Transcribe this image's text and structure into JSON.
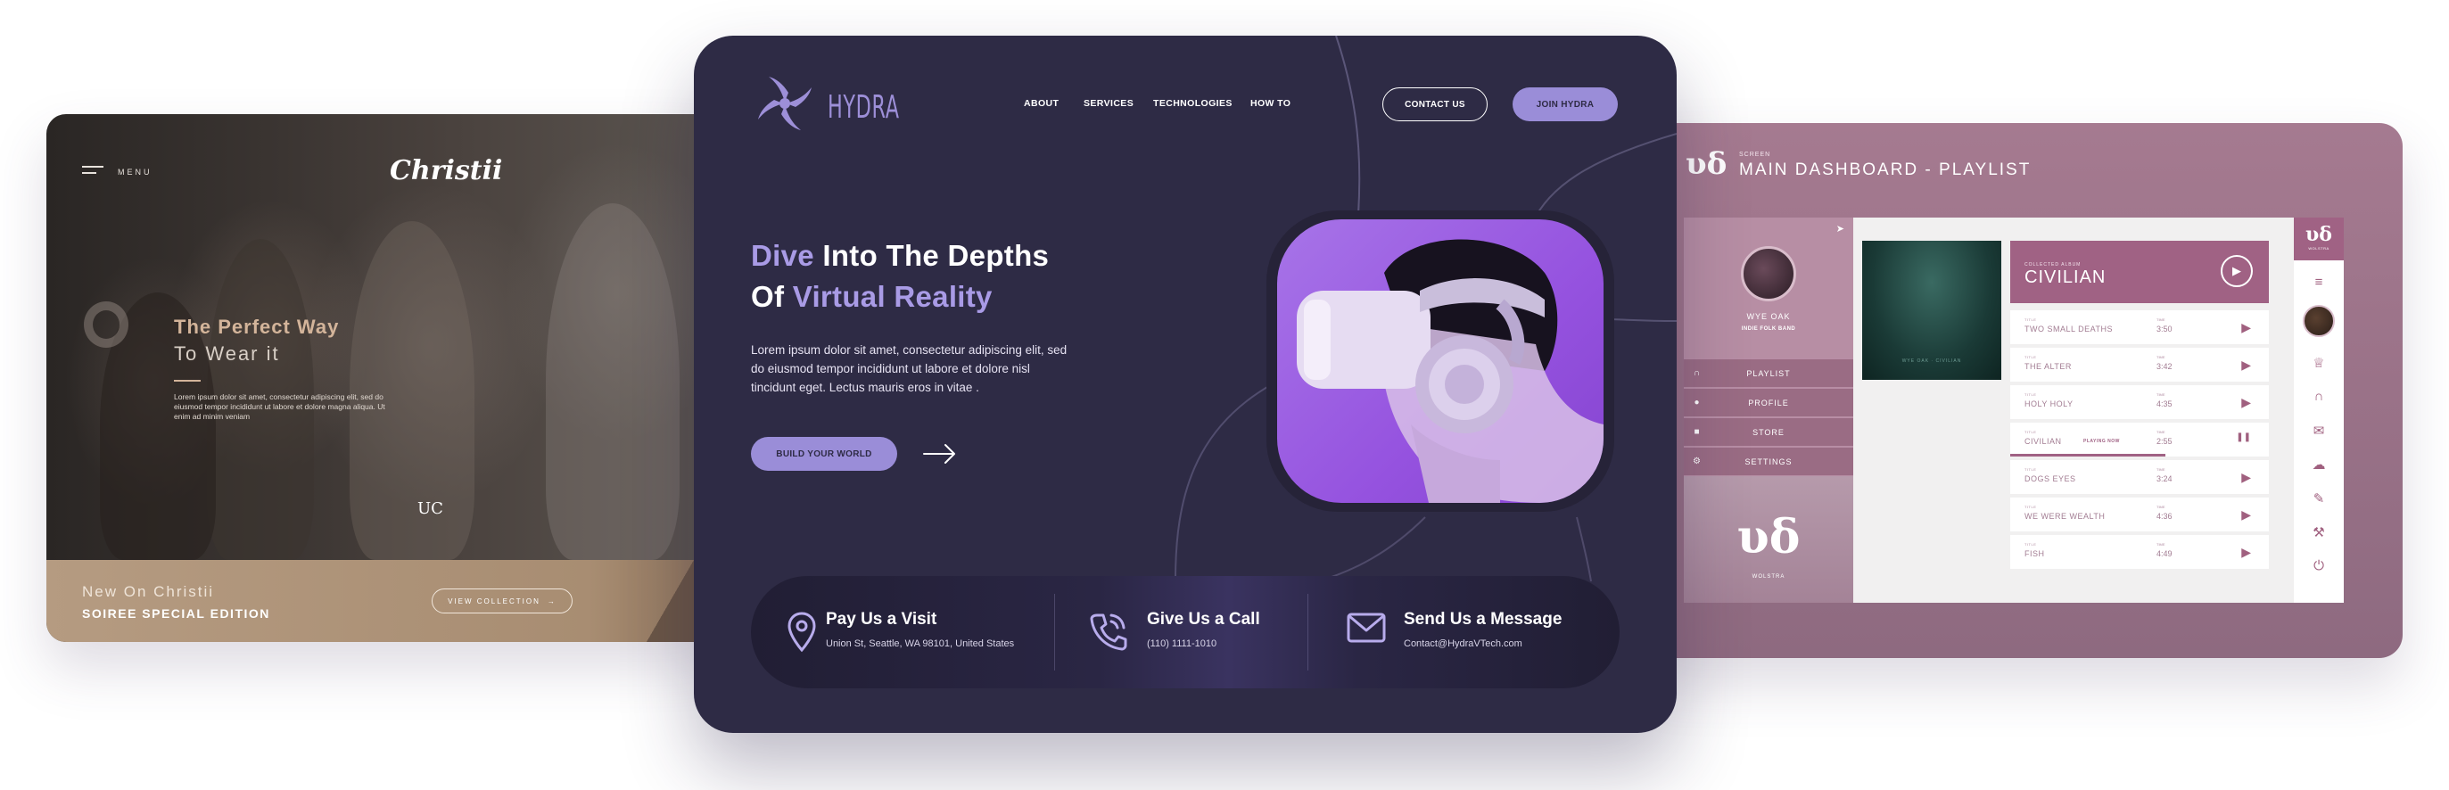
{
  "left_card": {
    "menu_label": "MENU",
    "logo": "Christii",
    "big_letter": "O",
    "headline_1": "The Perfect Way",
    "headline_2": "To Wear it",
    "description": "Lorem ipsum dolor sit amet, consectetur adipiscing elit, sed do eiusmod tempor incididunt ut labore et dolore magna aliqua. Ut enim ad minim veniam",
    "monogram": "UC",
    "footer_kicker": "New On Christii",
    "footer_title": "SOIREE SPECIAL EDITION",
    "footer_button": "VIEW COLLECTION",
    "footer_button_arrow": "→"
  },
  "center_card": {
    "brand": "HYDRA",
    "nav": [
      "ABOUT",
      "SERVICES",
      "TECHNOLOGIES",
      "HOW TO"
    ],
    "contact_button": "CONTACT US",
    "join_button": "JOIN HYDRA",
    "hero_line1_accent": "Dive",
    "hero_line1_rest": " Into The Depths",
    "hero_line2_start": "Of ",
    "hero_line2_accent": "Virtual Reality",
    "hero_description": "Lorem ipsum dolor sit amet, consectetur adipiscing elit, sed do eiusmod tempor incididunt ut labore et dolore nisl tincidunt eget. Lectus mauris eros in vitae .",
    "cta_button": "BUILD YOUR WORLD",
    "contacts": [
      {
        "title": "Pay Us a Visit",
        "detail": "Union St, Seattle, WA 98101, United States",
        "icon": "location-pin-icon"
      },
      {
        "title": "Give Us a Call",
        "detail": "(110) 1111-1010",
        "icon": "phone-icon"
      },
      {
        "title": "Send Us a Message",
        "detail": "Contact@HydraVTech.com",
        "icon": "envelope-icon"
      }
    ],
    "colors": {
      "background": "#2e2b45",
      "accent": "#a99be6",
      "button": "#9a8dd8",
      "hero_image": "#9552df"
    }
  },
  "right_card": {
    "screen_label": "SCREEN",
    "title": "MAIN DASHBOARD - PLAYLIST",
    "artist_name": "WYE OAK",
    "artist_sub": "INDIE FOLK BAND",
    "menu": [
      {
        "label": "PLAYLIST",
        "icon": "headphones-icon"
      },
      {
        "label": "PROFILE",
        "icon": "microphone-icon"
      },
      {
        "label": "STORE",
        "icon": "cart-icon"
      },
      {
        "label": "SETTINGS",
        "icon": "gears-icon"
      }
    ],
    "brand_label": "WOLSTRA",
    "album_caption": "WYE OAK · CIVILIAN",
    "now_playing_label": "COLLECTED ALBUM",
    "now_playing_title": "CIVILIAN",
    "title_label": "TITLE",
    "time_label": "TIME",
    "tracks": [
      {
        "title": "TWO SMALL DEATHS",
        "time": "3:50",
        "status": ""
      },
      {
        "title": "THE ALTER",
        "time": "3:42",
        "status": ""
      },
      {
        "title": "HOLY HOLY",
        "time": "4:35",
        "status": ""
      },
      {
        "title": "CIVILIAN",
        "time": "2:55",
        "status": "PLAYING NOW",
        "playing": true,
        "progress": 0.6
      },
      {
        "title": "DOGS EYES",
        "time": "3:24",
        "status": ""
      },
      {
        "title": "WE WERE WEALTH",
        "time": "4:36",
        "status": ""
      },
      {
        "title": "FISH",
        "time": "4:49",
        "status": ""
      }
    ],
    "rail_brand_sub": "WOLSTRA",
    "rail_icons": [
      "hamburger-icon",
      "trophy-icon",
      "headphones-icon",
      "mail-icon",
      "weather-icon",
      "pencil-icon",
      "wrench-icon",
      "power-icon"
    ],
    "colors": {
      "card": "#a57a90",
      "accent": "#a06284",
      "sidebar": "#b78ea4"
    }
  }
}
